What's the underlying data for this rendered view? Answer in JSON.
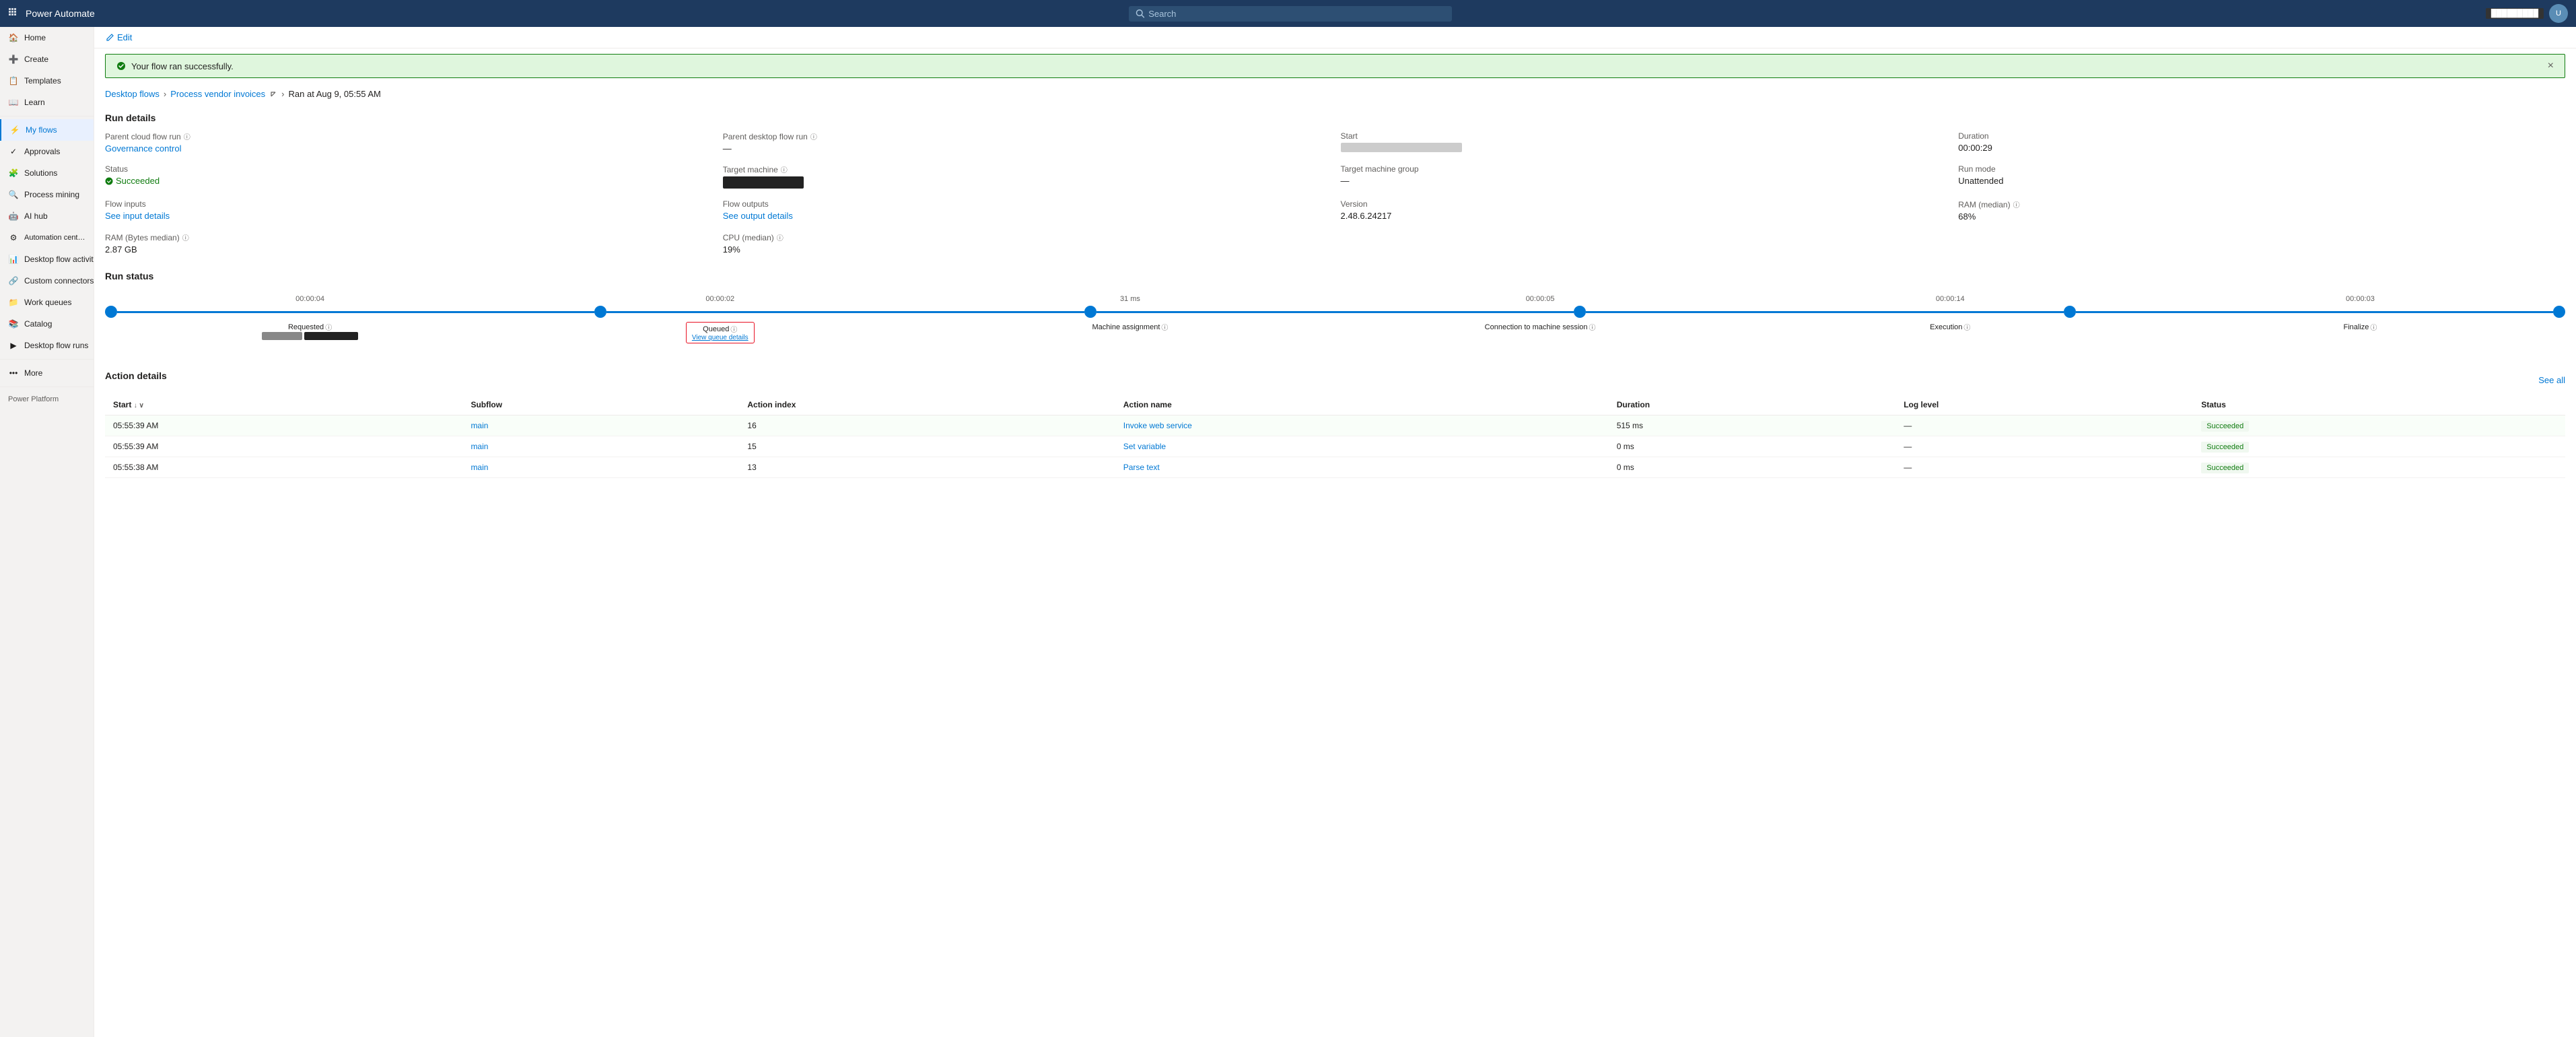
{
  "topbar": {
    "app_name": "Power Automate",
    "search_placeholder": "Search",
    "badge_text": "█████████",
    "waffle_icon": "waffle",
    "settings_icon": "settings",
    "help_icon": "help",
    "avatar_text": "U"
  },
  "sidebar": {
    "items": [
      {
        "id": "home",
        "label": "Home",
        "icon": "home"
      },
      {
        "id": "create",
        "label": "Create",
        "icon": "plus"
      },
      {
        "id": "templates",
        "label": "Templates",
        "icon": "template"
      },
      {
        "id": "learn",
        "label": "Learn",
        "icon": "book"
      },
      {
        "id": "my-flows",
        "label": "My flows",
        "icon": "flow",
        "active": true
      },
      {
        "id": "approvals",
        "label": "Approvals",
        "icon": "check"
      },
      {
        "id": "solutions",
        "label": "Solutions",
        "icon": "solutions"
      },
      {
        "id": "process-mining",
        "label": "Process mining",
        "icon": "mining"
      },
      {
        "id": "ai-hub",
        "label": "AI hub",
        "icon": "ai"
      },
      {
        "id": "automation-center",
        "label": "Automation center (previe...",
        "icon": "automation"
      },
      {
        "id": "desktop-flow-activity",
        "label": "Desktop flow activity",
        "icon": "activity"
      },
      {
        "id": "custom-connectors",
        "label": "Custom connectors",
        "icon": "connector"
      },
      {
        "id": "work-queues",
        "label": "Work queues",
        "icon": "queue"
      },
      {
        "id": "catalog",
        "label": "Catalog",
        "icon": "catalog"
      },
      {
        "id": "desktop-flow-runs",
        "label": "Desktop flow runs",
        "icon": "runs"
      },
      {
        "id": "more",
        "label": "More",
        "icon": "more"
      }
    ],
    "footer": {
      "label": "Power Platform",
      "icon": "platform"
    }
  },
  "toolbar": {
    "edit_label": "Edit"
  },
  "success_banner": {
    "message": "Your flow ran successfully.",
    "close_icon": "×"
  },
  "breadcrumb": {
    "items": [
      {
        "label": "Desktop flows",
        "href": "#"
      },
      {
        "label": "Process vendor invoices",
        "href": "#"
      },
      {
        "label": "Ran at Aug 9, 05:55 AM"
      }
    ]
  },
  "run_details": {
    "title": "Run details",
    "fields": [
      {
        "label": "Parent cloud flow run",
        "info": true,
        "value": "Governance control",
        "value_type": "link"
      },
      {
        "label": "Parent desktop flow run",
        "info": true,
        "value": "—",
        "value_type": "text"
      },
      {
        "label": "Start",
        "info": false,
        "value": "blurred",
        "value_type": "blurred"
      },
      {
        "label": "Duration",
        "info": false,
        "value": "00:00:29",
        "value_type": "text"
      },
      {
        "label": "Status",
        "info": false,
        "value": "Succeeded",
        "value_type": "status"
      },
      {
        "label": "Target machine",
        "info": true,
        "value": "redacted",
        "value_type": "redacted"
      },
      {
        "label": "Target machine group",
        "info": false,
        "value": "—",
        "value_type": "text"
      },
      {
        "label": "Run mode",
        "info": false,
        "value": "Unattended",
        "value_type": "text"
      },
      {
        "label": "Flow inputs",
        "info": false,
        "value": "See input details",
        "value_type": "link"
      },
      {
        "label": "Flow outputs",
        "info": false,
        "value": "See output details",
        "value_type": "link"
      },
      {
        "label": "Version",
        "info": false,
        "value": "2.48.6.24217",
        "value_type": "text"
      },
      {
        "label": "RAM (median)",
        "info": true,
        "value": "68%",
        "value_type": "text"
      },
      {
        "label": "RAM (Bytes median)",
        "info": true,
        "value": "2.87 GB",
        "value_type": "text"
      },
      {
        "label": "CPU (median)",
        "info": true,
        "value": "19%",
        "value_type": "text"
      }
    ]
  },
  "run_status": {
    "title": "Run status",
    "steps": [
      {
        "id": "requested",
        "label": "Requested",
        "duration": "00:00:04",
        "has_info": true,
        "sub_label": null,
        "queued": false
      },
      {
        "id": "queued",
        "label": "Queued",
        "duration": "00:00:02",
        "has_info": true,
        "sub_label": "View queue details",
        "queued": true
      },
      {
        "id": "machine-assignment",
        "label": "Machine assignment",
        "duration": "31 ms",
        "has_info": true,
        "sub_label": null,
        "queued": false
      },
      {
        "id": "connection-to-machine",
        "label": "Connection to machine session",
        "duration": "00:00:05",
        "has_info": true,
        "sub_label": null,
        "queued": false
      },
      {
        "id": "execution",
        "label": "Execution",
        "duration": "00:00:14",
        "has_info": true,
        "sub_label": null,
        "queued": false
      },
      {
        "id": "finalize",
        "label": "Finalize",
        "duration": "00:00:03",
        "has_info": true,
        "sub_label": null,
        "queued": false
      }
    ]
  },
  "action_details": {
    "title": "Action details",
    "see_all_label": "See all",
    "columns": [
      {
        "id": "start",
        "label": "Start",
        "sortable": true
      },
      {
        "id": "subflow",
        "label": "Subflow",
        "sortable": false
      },
      {
        "id": "action-index",
        "label": "Action index",
        "sortable": false
      },
      {
        "id": "action-name",
        "label": "Action name",
        "sortable": false
      },
      {
        "id": "duration",
        "label": "Duration",
        "sortable": false
      },
      {
        "id": "log-level",
        "label": "Log level",
        "sortable": false
      },
      {
        "id": "status",
        "label": "Status",
        "sortable": false
      }
    ],
    "rows": [
      {
        "start": "05:55:39 AM",
        "subflow": "main",
        "action_index": "16",
        "action_name": "Invoke web service",
        "duration": "515 ms",
        "log_level": "—",
        "status": "Succeeded"
      },
      {
        "start": "05:55:39 AM",
        "subflow": "main",
        "action_index": "15",
        "action_name": "Set variable",
        "duration": "0 ms",
        "log_level": "—",
        "status": "Succeeded"
      },
      {
        "start": "05:55:38 AM",
        "subflow": "main",
        "action_index": "13",
        "action_name": "Parse text",
        "duration": "0 ms",
        "log_level": "—",
        "status": "Succeeded"
      }
    ]
  },
  "colors": {
    "primary": "#0078d4",
    "success": "#107c10",
    "danger": "#e81123",
    "sidebar_bg": "#f3f2f1",
    "topbar_bg": "#1e3a5f"
  }
}
